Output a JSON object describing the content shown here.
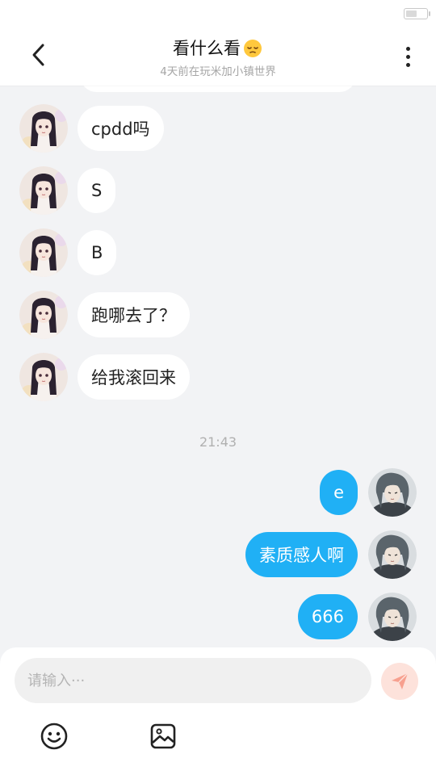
{
  "status_bar": {
    "battery_level": 0.55
  },
  "header": {
    "title": "看什么看",
    "title_emoji": "pensive-face-emoji",
    "subtitle": "4天前在玩米加小镇世界",
    "back_icon": "chevron-left-icon",
    "more_icon": "more-vertical-icon"
  },
  "messages": [
    {
      "direction": "incoming",
      "sender": "other",
      "text": "cpdd吗"
    },
    {
      "direction": "incoming",
      "sender": "other",
      "text": "S"
    },
    {
      "direction": "incoming",
      "sender": "other",
      "text": "B"
    },
    {
      "direction": "incoming",
      "sender": "other",
      "text": "跑哪去了？"
    },
    {
      "direction": "incoming",
      "sender": "other",
      "text": "给我滚回来"
    },
    {
      "divider": "21:43"
    },
    {
      "direction": "outgoing",
      "sender": "me",
      "text": "e"
    },
    {
      "direction": "outgoing",
      "sender": "me",
      "text": "素质感人啊"
    },
    {
      "direction": "outgoing",
      "sender": "me",
      "text": "666"
    }
  ],
  "composer": {
    "placeholder": "请输入···",
    "send_icon": "paper-plane-icon",
    "emoji_icon": "smiley-icon",
    "image_icon": "image-icon"
  },
  "colors": {
    "outgoing_bubble": "#20b0f5",
    "incoming_bubble": "#ffffff",
    "background": "#f2f3f5",
    "send_button_bg": "#fde2db",
    "send_button_icon": "#f7a08f"
  }
}
